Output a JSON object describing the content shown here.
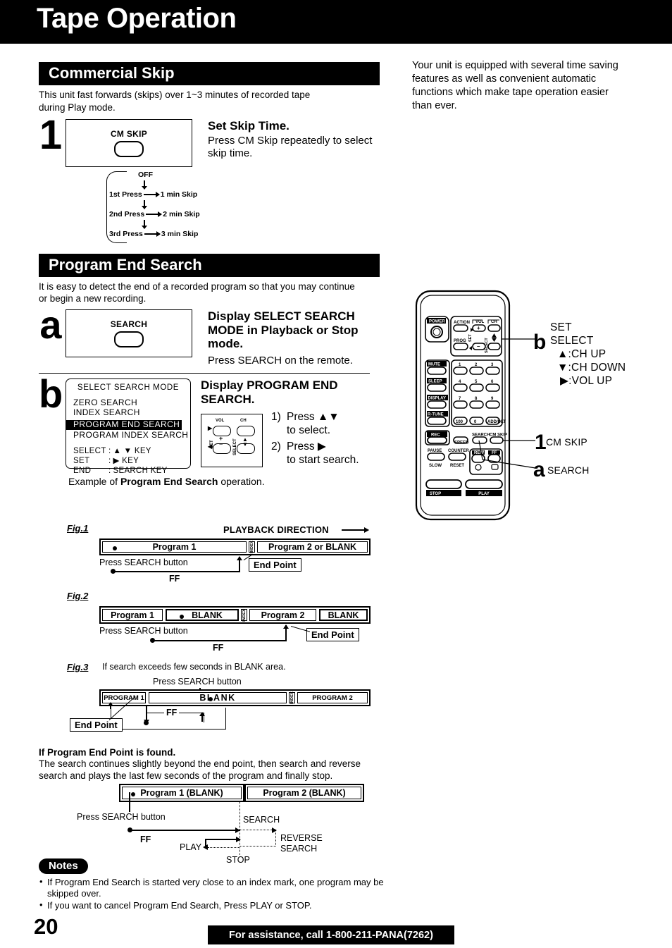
{
  "header": {
    "title": "Tape Operation"
  },
  "intro": {
    "text": "Your unit is equipped with several time saving features as well as convenient automatic functions which make tape operation easier than ever."
  },
  "commercial_skip": {
    "section_title": "Commercial Skip",
    "description": "This unit fast forwards (skips) over 1~3 minutes of recorded tape during Play mode.",
    "step": {
      "number": "1",
      "button_label": "CM SKIP",
      "heading": "Set Skip Time.",
      "subtext": "Press CM Skip repeatedly to select skip time."
    },
    "flow": {
      "off": "OFF",
      "rows": [
        {
          "press": "1st  Press",
          "result": "1 min Skip"
        },
        {
          "press": "2nd Press",
          "result": "2 min Skip"
        },
        {
          "press": "3rd  Press",
          "result": "3 min Skip"
        }
      ]
    }
  },
  "program_end_search": {
    "section_title": "Program End Search",
    "description": "It is easy to detect the end of a recorded program so that you may continue or begin a new recording.",
    "step_a": {
      "letter": "a",
      "button_label": "SEARCH",
      "heading": "Display SELECT SEARCH MODE in Playback or Stop mode.",
      "subtext": "Press SEARCH on the remote."
    },
    "step_b": {
      "letter": "b",
      "heading": "Display PROGRAM END SEARCH.",
      "instructions": [
        {
          "num": "1)",
          "line1": "Press ▲▼",
          "line2": "to select."
        },
        {
          "num": "2)",
          "line1": "Press ▶",
          "line2": "to start search."
        }
      ],
      "osd": {
        "title": "SELECT SEARCH MODE",
        "items": [
          "ZERO  SEARCH",
          "INDEX  SEARCH",
          "PROGRAM   END   SEARCH",
          "PROGRAM  INDEX  SEARCH"
        ],
        "highlighted_index": 2,
        "keys": [
          {
            "label": "SELECT",
            "sep": ":",
            "value": "▲ ▼  KEY"
          },
          {
            "label": "SET",
            "sep": ":",
            "value": "▶  KEY"
          },
          {
            "label": "END",
            "sep": ":",
            "value": "SEARCH  KEY"
          }
        ]
      },
      "mini_keys": {
        "vol": "VOL",
        "ch": "CH",
        "set": "SET",
        "select": "SELECT",
        "plus": "+",
        "minus": "−"
      }
    },
    "example_caption_pre": "Example of ",
    "example_caption_bold": "Program End Search",
    "example_caption_post": " operation.",
    "figures": [
      {
        "label": "Fig.1",
        "direction_label": "PLAYBACK DIRECTION",
        "segments": [
          "Program 1",
          "Program 2 or BLANK"
        ],
        "index_label": "INDEX",
        "press_label": "Press SEARCH button",
        "ff_label": "FF",
        "end_point_label": "End Point"
      },
      {
        "label": "Fig.2",
        "segments": [
          "Program 1",
          "BLANK",
          "Program 2",
          "BLANK"
        ],
        "index_label": "INDEX",
        "press_label": "Press SEARCH button",
        "ff_label": "FF",
        "end_point_label": "End Point"
      },
      {
        "label": "Fig.3",
        "note": "If search exceeds few seconds in BLANK area.",
        "segments": [
          "PROGRAM 1",
          "BLANK",
          "PROGRAM 2"
        ],
        "index_label": "INDEX",
        "press_label": "Press SEARCH button",
        "ff_label": "FF",
        "end_point_label": "End Point"
      }
    ],
    "end_point_found": {
      "heading": "If Program End Point is found.",
      "body": "The search continues slightly beyond the end point, then search and reverse search and plays the last few seconds of the program and finally stop.",
      "segments": [
        "Program 1 (BLANK)",
        "Program 2 (BLANK)"
      ],
      "press_label": "Press SEARCH button",
      "ff_label": "FF",
      "play_label": "PLAY",
      "stop_label": "STOP",
      "search_label": "SEARCH",
      "reverse_search_label_1": "REVERSE",
      "reverse_search_label_2": "SEARCH"
    }
  },
  "notes": {
    "badge": "Notes",
    "items": [
      "If Program End Search is started very close to an index mark, one program may be skipped over.",
      "If you want to cancel Program End Search, Press PLAY or STOP."
    ]
  },
  "remote": {
    "buttons": {
      "power": "POWER",
      "action": "ACTION",
      "prog": "PROG",
      "vol": "VOL",
      "ch": "CH",
      "set": "SET",
      "select": "SELECT",
      "mute": "MUTE",
      "sleep": "SLEEP",
      "display": "DISPLAY",
      "rtune": "R-TUNE",
      "rec": "REC",
      "speed": "SPEED",
      "search": "SEARCH",
      "cm_skip": "CM SKIP",
      "pause": "PAUSE",
      "counter": "COUNTER",
      "slow": "SLOW",
      "reset": "RESET",
      "rew": "REW",
      "ff": "FF",
      "stop": "STOP",
      "play": "PLAY",
      "add_dlt": "ADD/DLT",
      "hundred": "100",
      "zero": "0",
      "num1": "1",
      "num2": "2",
      "num3": "3",
      "num4": "4",
      "num5": "5",
      "num6": "6",
      "num7": "7",
      "num8": "8",
      "num9": "9"
    },
    "callouts": [
      {
        "letter": "b",
        "lines": [
          "SET",
          "SELECT",
          "▲:CH UP",
          "▼:CH DOWN",
          "▶:VOL UP"
        ]
      },
      {
        "letter": "1",
        "lines": [
          "CM SKIP"
        ]
      },
      {
        "letter": "a",
        "lines": [
          "SEARCH"
        ]
      }
    ]
  },
  "footer": {
    "page_number": "20",
    "assistance": "For assistance, call 1-800-211-PANA(7262)"
  }
}
